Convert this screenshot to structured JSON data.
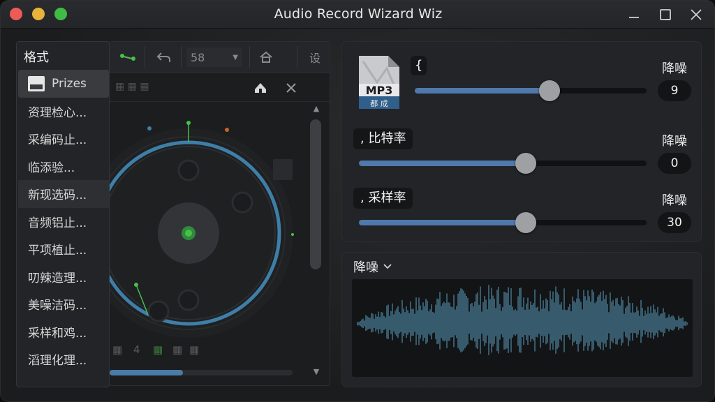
{
  "window": {
    "title": "Audio Record Wizard Wiz"
  },
  "toolbar": {
    "zoom_value": "58",
    "settings_label": "设"
  },
  "format_panel": {
    "header": "格式",
    "items": [
      {
        "label": "Prizes"
      },
      {
        "label": "资理检心..."
      },
      {
        "label": "采编码止..."
      },
      {
        "label": "临添验..."
      },
      {
        "label": "新现选码..."
      },
      {
        "label": "音频铝止..."
      },
      {
        "label": "平项植止..."
      },
      {
        "label": "叨辣造理..."
      },
      {
        "label": "美噪洁码..."
      },
      {
        "label": "采样和鸡..."
      },
      {
        "label": "滔理化理..."
      }
    ]
  },
  "settings": {
    "file_icon_text": "MP3",
    "file_icon_subtext": "都 成",
    "row1": {
      "label": "{",
      "side_label": "降噪",
      "value": "9",
      "fraction": 0.58
    },
    "row2": {
      "label": ", 比特率",
      "side_label": "降噪",
      "value": "0",
      "fraction": 0.58
    },
    "row3": {
      "label": ", 采样率",
      "side_label": "降噪",
      "value": "30",
      "fraction": 0.58
    }
  },
  "waveform": {
    "title": "降噪"
  },
  "progress": {
    "fraction": 0.4
  },
  "colors": {
    "accent": "#4f79ad",
    "wave": "#5aa0c0",
    "dial": "#3e7fa8",
    "green": "#46c04a"
  }
}
